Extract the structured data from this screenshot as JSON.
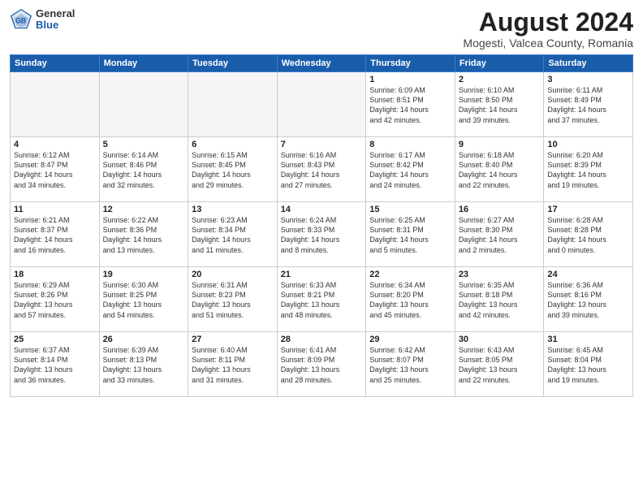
{
  "header": {
    "logo_general": "General",
    "logo_blue": "Blue",
    "title": "August 2024",
    "location": "Mogesti, Valcea County, Romania"
  },
  "weekdays": [
    "Sunday",
    "Monday",
    "Tuesday",
    "Wednesday",
    "Thursday",
    "Friday",
    "Saturday"
  ],
  "weeks": [
    [
      {
        "day": "",
        "detail": ""
      },
      {
        "day": "",
        "detail": ""
      },
      {
        "day": "",
        "detail": ""
      },
      {
        "day": "",
        "detail": ""
      },
      {
        "day": "1",
        "detail": "Sunrise: 6:09 AM\nSunset: 8:51 PM\nDaylight: 14 hours\nand 42 minutes."
      },
      {
        "day": "2",
        "detail": "Sunrise: 6:10 AM\nSunset: 8:50 PM\nDaylight: 14 hours\nand 39 minutes."
      },
      {
        "day": "3",
        "detail": "Sunrise: 6:11 AM\nSunset: 8:49 PM\nDaylight: 14 hours\nand 37 minutes."
      }
    ],
    [
      {
        "day": "4",
        "detail": "Sunrise: 6:12 AM\nSunset: 8:47 PM\nDaylight: 14 hours\nand 34 minutes."
      },
      {
        "day": "5",
        "detail": "Sunrise: 6:14 AM\nSunset: 8:46 PM\nDaylight: 14 hours\nand 32 minutes."
      },
      {
        "day": "6",
        "detail": "Sunrise: 6:15 AM\nSunset: 8:45 PM\nDaylight: 14 hours\nand 29 minutes."
      },
      {
        "day": "7",
        "detail": "Sunrise: 6:16 AM\nSunset: 8:43 PM\nDaylight: 14 hours\nand 27 minutes."
      },
      {
        "day": "8",
        "detail": "Sunrise: 6:17 AM\nSunset: 8:42 PM\nDaylight: 14 hours\nand 24 minutes."
      },
      {
        "day": "9",
        "detail": "Sunrise: 6:18 AM\nSunset: 8:40 PM\nDaylight: 14 hours\nand 22 minutes."
      },
      {
        "day": "10",
        "detail": "Sunrise: 6:20 AM\nSunset: 8:39 PM\nDaylight: 14 hours\nand 19 minutes."
      }
    ],
    [
      {
        "day": "11",
        "detail": "Sunrise: 6:21 AM\nSunset: 8:37 PM\nDaylight: 14 hours\nand 16 minutes."
      },
      {
        "day": "12",
        "detail": "Sunrise: 6:22 AM\nSunset: 8:36 PM\nDaylight: 14 hours\nand 13 minutes."
      },
      {
        "day": "13",
        "detail": "Sunrise: 6:23 AM\nSunset: 8:34 PM\nDaylight: 14 hours\nand 11 minutes."
      },
      {
        "day": "14",
        "detail": "Sunrise: 6:24 AM\nSunset: 8:33 PM\nDaylight: 14 hours\nand 8 minutes."
      },
      {
        "day": "15",
        "detail": "Sunrise: 6:25 AM\nSunset: 8:31 PM\nDaylight: 14 hours\nand 5 minutes."
      },
      {
        "day": "16",
        "detail": "Sunrise: 6:27 AM\nSunset: 8:30 PM\nDaylight: 14 hours\nand 2 minutes."
      },
      {
        "day": "17",
        "detail": "Sunrise: 6:28 AM\nSunset: 8:28 PM\nDaylight: 14 hours\nand 0 minutes."
      }
    ],
    [
      {
        "day": "18",
        "detail": "Sunrise: 6:29 AM\nSunset: 8:26 PM\nDaylight: 13 hours\nand 57 minutes."
      },
      {
        "day": "19",
        "detail": "Sunrise: 6:30 AM\nSunset: 8:25 PM\nDaylight: 13 hours\nand 54 minutes."
      },
      {
        "day": "20",
        "detail": "Sunrise: 6:31 AM\nSunset: 8:23 PM\nDaylight: 13 hours\nand 51 minutes."
      },
      {
        "day": "21",
        "detail": "Sunrise: 6:33 AM\nSunset: 8:21 PM\nDaylight: 13 hours\nand 48 minutes."
      },
      {
        "day": "22",
        "detail": "Sunrise: 6:34 AM\nSunset: 8:20 PM\nDaylight: 13 hours\nand 45 minutes."
      },
      {
        "day": "23",
        "detail": "Sunrise: 6:35 AM\nSunset: 8:18 PM\nDaylight: 13 hours\nand 42 minutes."
      },
      {
        "day": "24",
        "detail": "Sunrise: 6:36 AM\nSunset: 8:16 PM\nDaylight: 13 hours\nand 39 minutes."
      }
    ],
    [
      {
        "day": "25",
        "detail": "Sunrise: 6:37 AM\nSunset: 8:14 PM\nDaylight: 13 hours\nand 36 minutes."
      },
      {
        "day": "26",
        "detail": "Sunrise: 6:39 AM\nSunset: 8:13 PM\nDaylight: 13 hours\nand 33 minutes."
      },
      {
        "day": "27",
        "detail": "Sunrise: 6:40 AM\nSunset: 8:11 PM\nDaylight: 13 hours\nand 31 minutes."
      },
      {
        "day": "28",
        "detail": "Sunrise: 6:41 AM\nSunset: 8:09 PM\nDaylight: 13 hours\nand 28 minutes."
      },
      {
        "day": "29",
        "detail": "Sunrise: 6:42 AM\nSunset: 8:07 PM\nDaylight: 13 hours\nand 25 minutes."
      },
      {
        "day": "30",
        "detail": "Sunrise: 6:43 AM\nSunset: 8:05 PM\nDaylight: 13 hours\nand 22 minutes."
      },
      {
        "day": "31",
        "detail": "Sunrise: 6:45 AM\nSunset: 8:04 PM\nDaylight: 13 hours\nand 19 minutes."
      }
    ]
  ]
}
